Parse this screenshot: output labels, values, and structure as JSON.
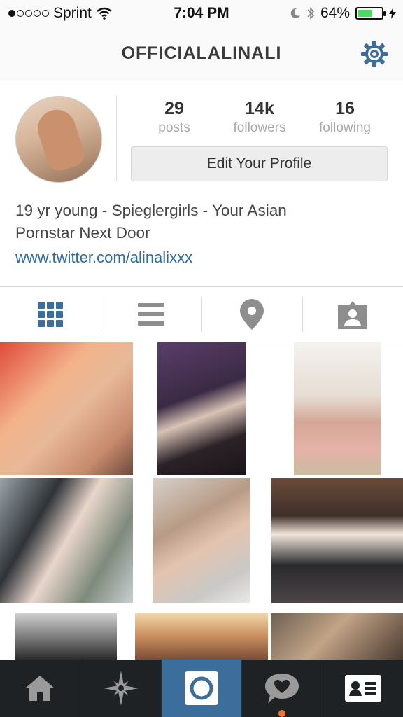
{
  "status_bar": {
    "carrier": "Sprint",
    "time": "7:04 PM",
    "battery": "64%",
    "battery_level": 0.64,
    "signal_bars": 1
  },
  "header": {
    "username": "OFFICIALALINALI",
    "settings_icon": "gear-icon"
  },
  "profile": {
    "stats": [
      {
        "value": "29",
        "label": "posts"
      },
      {
        "value": "14k",
        "label": "followers"
      },
      {
        "value": "16",
        "label": "following"
      }
    ],
    "edit_button": "Edit Your Profile",
    "bio_line1": "19 yr young - Spieglergirls - Your Asian",
    "bio_line2": "Pornstar Next Door",
    "website": "www.twitter.com/alinalixxx"
  },
  "view_tabs": [
    {
      "icon": "grid-icon",
      "active": true
    },
    {
      "icon": "list-icon",
      "active": false
    },
    {
      "icon": "location-pin-icon",
      "active": false
    },
    {
      "icon": "tagged-person-icon",
      "active": false
    }
  ],
  "bottom_tabs": [
    {
      "icon": "home-icon",
      "active": false
    },
    {
      "icon": "explore-star-icon",
      "active": false
    },
    {
      "icon": "camera-icon",
      "active": true
    },
    {
      "icon": "activity-heart-icon",
      "active": false,
      "has_notification": true
    },
    {
      "icon": "profile-card-icon",
      "active": false
    }
  ],
  "colors": {
    "accent": "#3c6e9c",
    "link": "#2d6a9f",
    "tabbar": "#1f2225",
    "battery": "#4cd964",
    "notification": "#f2722b"
  }
}
